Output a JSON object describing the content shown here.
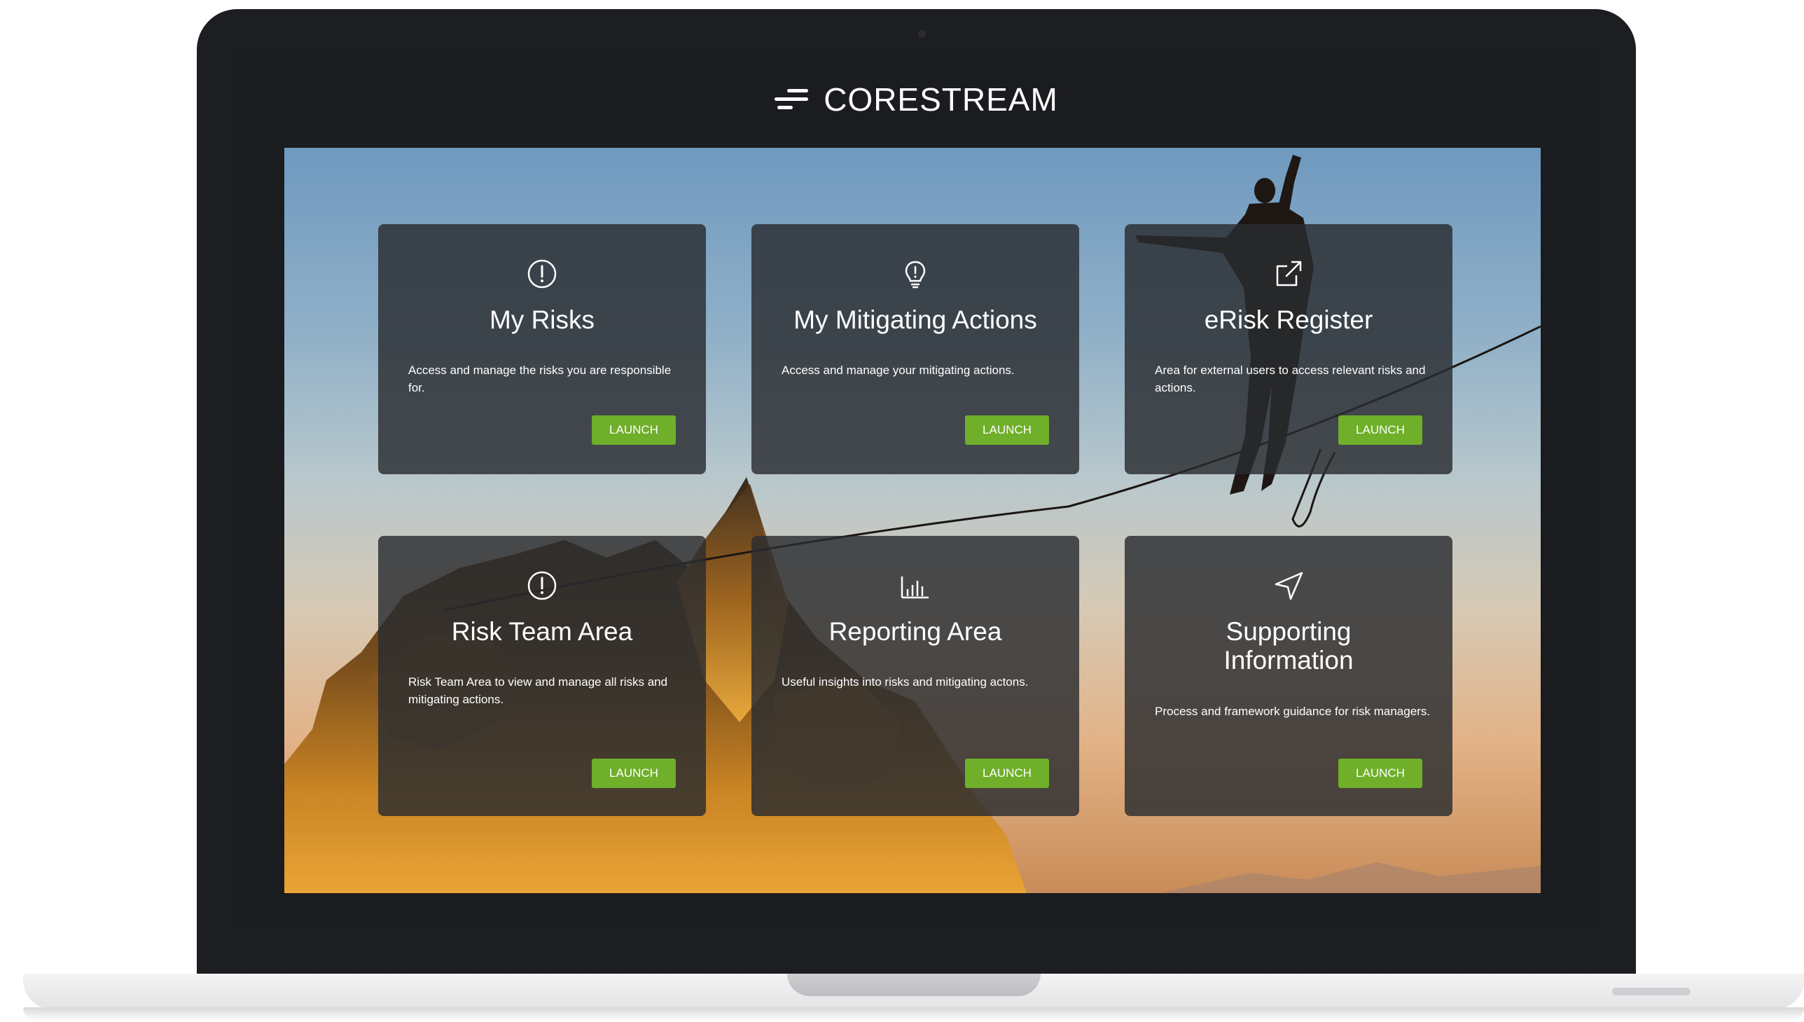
{
  "app": {
    "brand": "CORESTREAM"
  },
  "tiles": [
    {
      "icon": "alert-circle-icon",
      "title": "My Risks",
      "description": "Access and manage the risks you are responsible for.",
      "button": "LAUNCH"
    },
    {
      "icon": "lightbulb-icon",
      "title": "My Mitigating Actions",
      "description": "Access and manage your mitigating actions.",
      "button": "LAUNCH"
    },
    {
      "icon": "external-link-icon",
      "title": "eRisk Register",
      "description": "Area for external users to access relevant risks and actions.",
      "button": "LAUNCH"
    },
    {
      "icon": "alert-circle-icon",
      "title": "Risk Team Area",
      "description": "Risk Team Area to view and manage all risks and mitigating actions.",
      "button": "LAUNCH"
    },
    {
      "icon": "bar-chart-icon",
      "title": "Reporting Area",
      "description": "Useful insights into risks and mitigating actons.",
      "button": "LAUNCH"
    },
    {
      "icon": "navigation-arrow-icon",
      "title": "Supporting Information",
      "description": "Process and framework guidance for risk managers.",
      "button": "LAUNCH"
    }
  ],
  "colors": {
    "launch_button": "#6faf2a",
    "card_background": "#2a2c30",
    "bezel": "#1d1e22"
  }
}
